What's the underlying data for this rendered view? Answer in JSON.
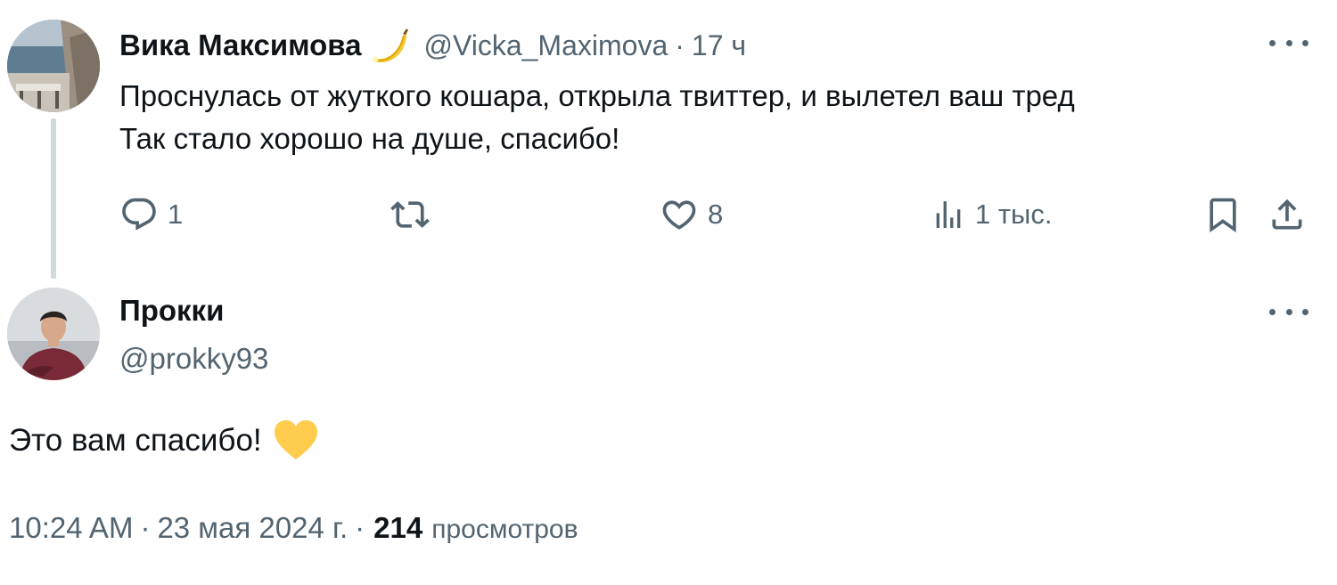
{
  "parent_tweet": {
    "author_name": "Вика Максимова",
    "author_emoji": "banana-emoji",
    "handle": "@Vicka_Maximova",
    "separator": "·",
    "time": "17 ч",
    "text_line1": "Проснулась от жуткого кошара, открыла твиттер, и вылетел ваш тред",
    "text_line2": "Так стало хорошо на душе, спасибо!",
    "actions": {
      "reply_count": "1",
      "retweet_count": "",
      "like_count": "8",
      "views_count": "1 тыс."
    }
  },
  "reply_tweet": {
    "author_name": "Прокки",
    "handle": "@prokky93",
    "text": "Это вам спасибо!",
    "text_emoji": "yellow-heart-emoji",
    "timestamp": "10:24 AM",
    "separator": "·",
    "date": "23 мая 2024 г.",
    "views_count": "214",
    "views_label": "просмотров"
  },
  "colors": {
    "text_primary": "#0f1419",
    "text_secondary": "#536471",
    "thread_line": "#cfd9de",
    "heart_yellow": "#ffcc4d"
  }
}
